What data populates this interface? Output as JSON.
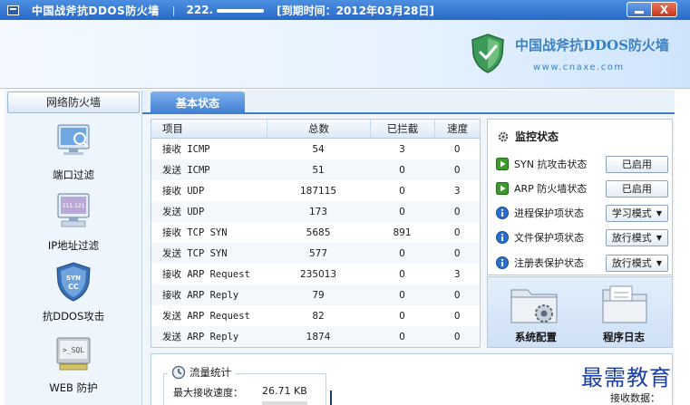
{
  "titlebar": {
    "title": "中国战斧抗DDOS防火墙",
    "separator": "|",
    "ip_prefix": "222.",
    "expiry": "[到期时间：2012年03月28日]",
    "minimize": "_",
    "close": "X"
  },
  "brand": {
    "name": "中国战斧抗DDOS防火墙",
    "url": "www.cnaxe.com"
  },
  "sidebar": {
    "title": "网络防火墙",
    "items": [
      {
        "label": "端口过滤"
      },
      {
        "label": "IP地址过滤"
      },
      {
        "label": "抗DDOS攻击",
        "icon_text": "SYN CC"
      },
      {
        "label": "WEB 防护",
        "icon_text": ">_SQL"
      }
    ]
  },
  "tabs": {
    "basic": "基本状态"
  },
  "stats": {
    "headers": [
      "项目",
      "总数",
      "已拦截",
      "速度"
    ],
    "rows": [
      {
        "item": "接收 ICMP",
        "total": "54",
        "blocked": "3",
        "speed": "0"
      },
      {
        "item": "发送 ICMP",
        "total": "51",
        "blocked": "0",
        "speed": "0"
      },
      {
        "item": "接收 UDP",
        "total": "187115",
        "blocked": "0",
        "speed": "3"
      },
      {
        "item": "发送 UDP",
        "total": "173",
        "blocked": "0",
        "speed": "0"
      },
      {
        "item": "接收 TCP SYN",
        "total": "5685",
        "blocked": "891",
        "speed": "0"
      },
      {
        "item": "发送 TCP SYN",
        "total": "577",
        "blocked": "0",
        "speed": "0"
      },
      {
        "item": "接收 ARP Request",
        "total": "235013",
        "blocked": "0",
        "speed": "3"
      },
      {
        "item": "接收 ARP Reply",
        "total": "79",
        "blocked": "0",
        "speed": "0"
      },
      {
        "item": "发送 ARP Request",
        "total": "82",
        "blocked": "0",
        "speed": "0"
      },
      {
        "item": "发送 ARP Reply",
        "total": "1874",
        "blocked": "0",
        "speed": "0"
      }
    ]
  },
  "monitor": {
    "title": "监控状态",
    "rows": [
      {
        "label": "SYN 抗攻击状态",
        "value": "已启用",
        "icon": "play-icon"
      },
      {
        "label": "ARP 防火墙状态",
        "value": "已启用",
        "icon": "play-icon"
      },
      {
        "label": "进程保护项状态",
        "value": "学习模式",
        "icon": "info-icon"
      },
      {
        "label": "文件保护项状态",
        "value": "放行模式",
        "icon": "info-icon"
      },
      {
        "label": "注册表保护状态",
        "value": "放行模式",
        "icon": "info-icon"
      }
    ]
  },
  "actions": {
    "config": "系统配置",
    "log": "程序日志"
  },
  "traffic": {
    "title": "流量统计",
    "max_recv_label": "最大接收速度：",
    "max_recv_value": "26.71 KB",
    "recv_data_label": "接收数据："
  },
  "watermark": "最需教育",
  "colors": {
    "titlebar": "#2868c8",
    "accent": "#3b7cd0",
    "enabled_icon": "#3a9d2a",
    "info_icon": "#2a6fd0"
  }
}
